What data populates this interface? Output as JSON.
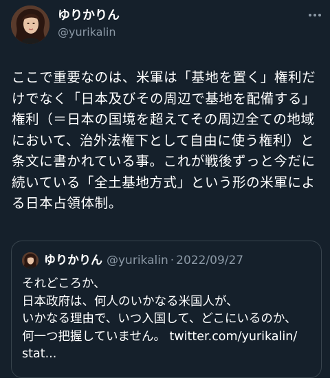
{
  "tweet": {
    "author": {
      "display_name": "ゆりかりん",
      "handle": "@yurikalin"
    },
    "text": "ここで重要なのは、米軍は「基地を置く」権利だけでなく「日本及びその周辺で基地を配備する」権利（＝日本の国境を超えてその周辺全ての地域において、治外法権下として自由に使う権利）と条文に書かれている事。これが戦後ずっと今だに続いている「全土基地方式」という形の米軍による日本占領体制。",
    "more_icon": "more-horizontal-icon"
  },
  "quote": {
    "author": {
      "display_name": "ゆりかりん",
      "handle": "@yurikalin"
    },
    "separator": "·",
    "date": "2022/09/27",
    "text": "それどころか、\n日本政府は、何人のいかなる米国人が、\nいかなる理由で、いつ入国して、どこにいるのか、\n何一つ把握していません。 twitter.com/yurikalin/\nstat..."
  },
  "colors": {
    "background": "#15202b",
    "text_primary": "#ffffff",
    "text_secondary": "#8b98a5",
    "border": "#38444d"
  }
}
